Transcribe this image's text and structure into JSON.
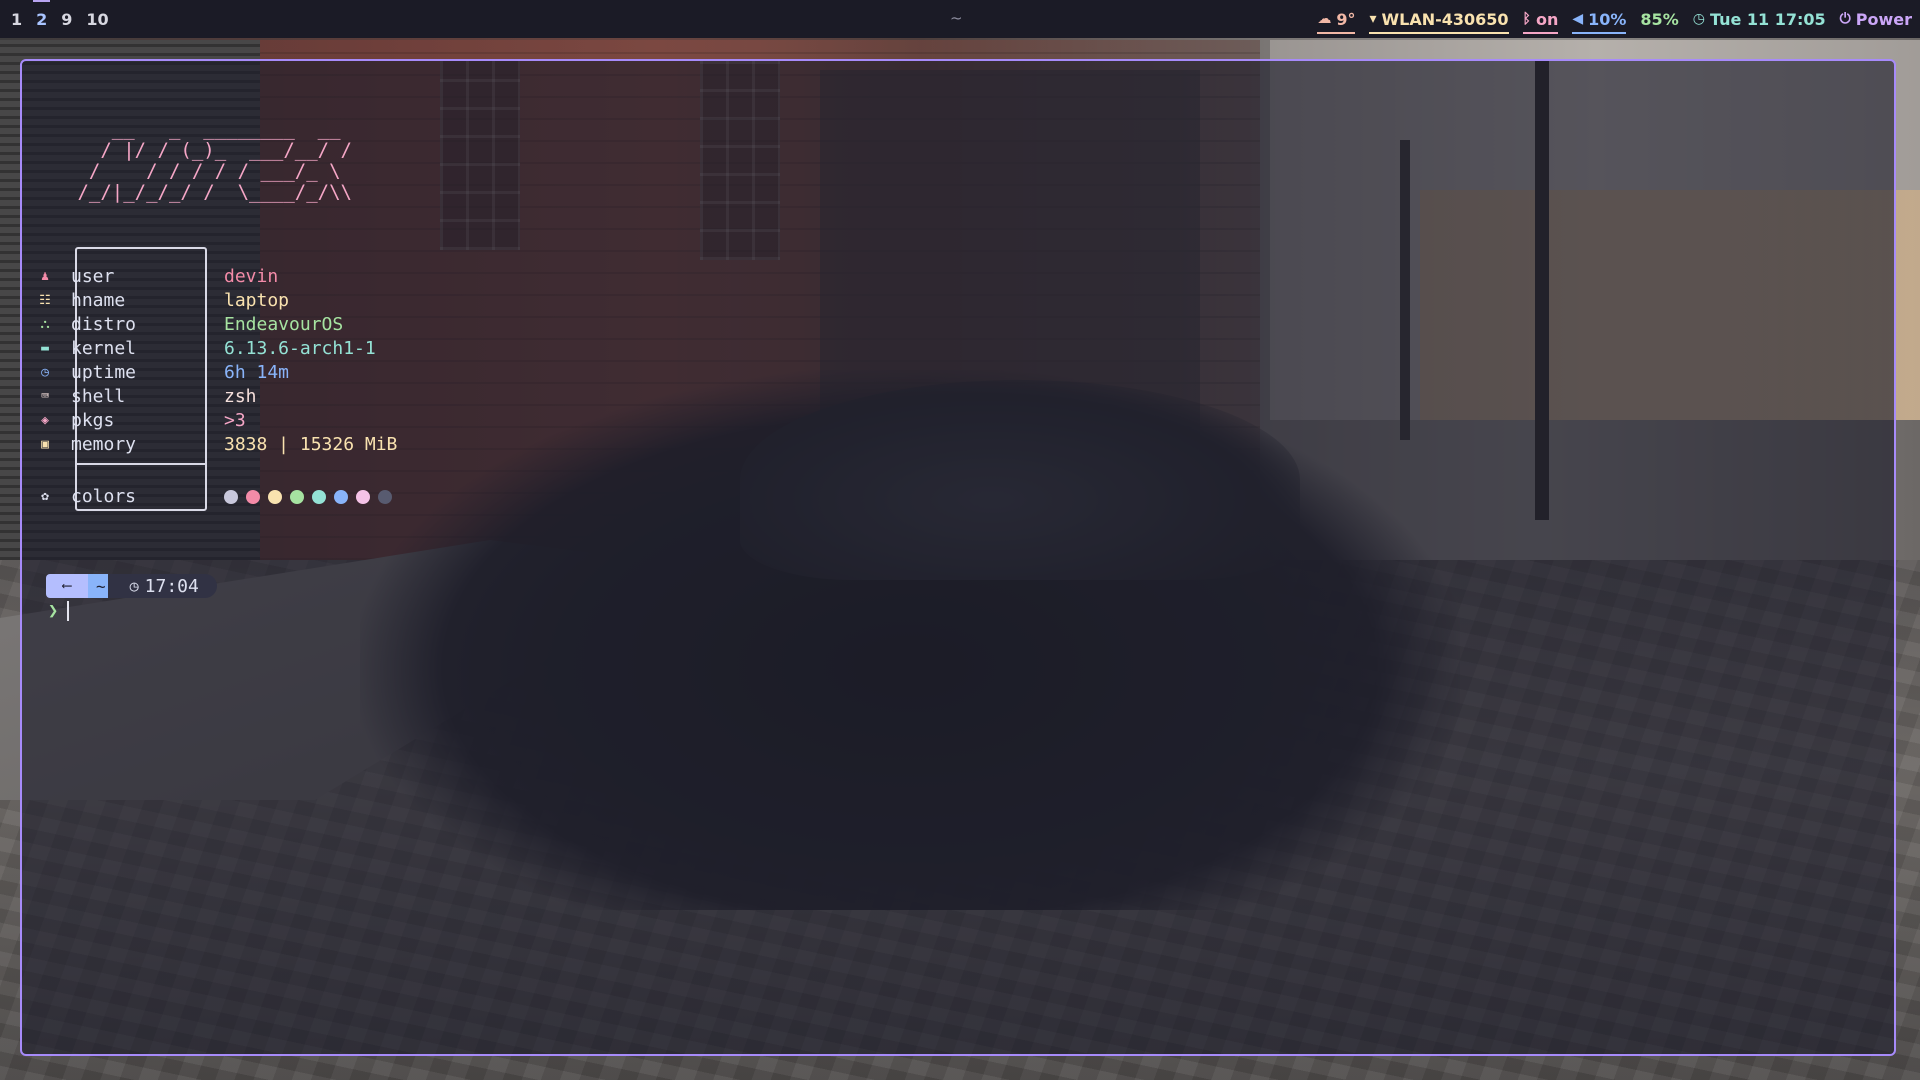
{
  "topbar": {
    "workspaces": [
      {
        "label": "1",
        "active": false
      },
      {
        "label": "2",
        "active": true
      },
      {
        "label": "9",
        "active": false
      },
      {
        "label": "10",
        "active": false
      }
    ],
    "window_title": "~",
    "weather": {
      "icon": "cloud-icon",
      "value": "9°"
    },
    "wifi": {
      "icon": "wifi-icon",
      "value": "WLAN-430650"
    },
    "bluetooth": {
      "icon": "bluetooth-icon",
      "value": "on"
    },
    "volume": {
      "icon": "volume-icon",
      "value": "10%"
    },
    "battery": {
      "value": "85%"
    },
    "clock": {
      "icon": "clock-icon",
      "value": "Tue 11 17:05"
    },
    "power": {
      "icon": "power-icon",
      "label": "Power"
    }
  },
  "terminal": {
    "logo_ascii": "    __   _  ________  __\n   / |/ / (_)_  ___/__/ /\n  /    / / / / / ___/_ \\\n /_/|_/_/_/ /  \\____/_/\\\\",
    "fetch": [
      {
        "icon": "user-icon",
        "key": "user",
        "value": "devin",
        "cls": "user",
        "color": "#f38ba8"
      },
      {
        "icon": "host-icon",
        "key": "hname",
        "value": "laptop",
        "cls": "hname",
        "color": "#f9e2af"
      },
      {
        "icon": "distro-icon",
        "key": "distro",
        "value": "EndeavourOS",
        "cls": "distro",
        "color": "#a6e3a1"
      },
      {
        "icon": "kernel-icon",
        "key": "kernel",
        "value": "6.13.6-arch1-1",
        "cls": "kernel",
        "color": "#94e2d5"
      },
      {
        "icon": "uptime-icon",
        "key": "uptime",
        "value": "6h 14m",
        "cls": "uptime",
        "color": "#89b4fa"
      },
      {
        "icon": "shell-icon",
        "key": "shell",
        "value": "zsh",
        "cls": "shell",
        "color": "#f5e0dc"
      },
      {
        "icon": "package-icon",
        "key": "pkgs",
        "value": ">3",
        "cls": "pkgs",
        "color": "#f5a6c6"
      },
      {
        "icon": "memory-icon",
        "key": "memory",
        "value": "3838 | 15326 MiB",
        "cls": "memory",
        "color": "#f9e2af"
      }
    ],
    "colors_row": {
      "icon": "palette-icon",
      "key": "colors"
    },
    "palette": [
      "#c8c8dc",
      "#f38ba8",
      "#f9e2af",
      "#a6e3a1",
      "#94e2d5",
      "#89b4fa",
      "#f5c2e7",
      "#585b70"
    ],
    "prompt": {
      "os_glyph": "arch-icon",
      "directory": "~",
      "time_icon": "clock-icon",
      "time": "17:04",
      "symbol": "❯"
    }
  }
}
